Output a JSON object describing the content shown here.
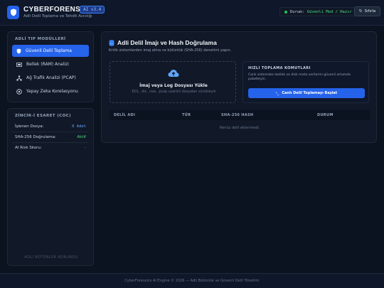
{
  "header": {
    "brand": "CYBERFORENSICS",
    "version": "AI v3.4",
    "subtitle": "Adli Delil Toplama ve Tehdit Avcılığı",
    "status_label": "Durum:",
    "status_value": "Güvenli Mod / Hazır",
    "reset_label": "Sıfırla"
  },
  "sidebar": {
    "modules_title": "ADLİ TIP MODÜLLERİ",
    "items": [
      {
        "label": "Güvenli Delil Toplama",
        "icon": "shield-icon"
      },
      {
        "label": "Bellek (RAM) Analizi",
        "icon": "memory-icon"
      },
      {
        "label": "Ağ Trafik Analizi (PCAP)",
        "icon": "network-icon"
      },
      {
        "label": "Yapay Zeka Korelasyonu",
        "icon": "brain-icon"
      }
    ],
    "coc_title": "ZİNCİR-İ ESARET (COC)",
    "coc_rows": [
      {
        "label": "İşlenen Dosya:",
        "value": "0 Adet"
      },
      {
        "label": "SHA-256 Doğrulama:",
        "value": "Aktif"
      },
      {
        "label": "AI Risk Skoru:",
        "value": "-"
      }
    ],
    "coc_footer": "ADLİ BÜTÜNLÜK KORUNDU"
  },
  "main": {
    "title": "Adli Delil İmajı ve Hash Doğrulama",
    "subtitle": "Kritik sistemlerden imaj alma ve bütünlük (SHA-256) denetimi yapın.",
    "upload_title": "İmaj veya Log Dosyası Yükle",
    "upload_sub": ".E01, .dd, .raw, .pcap uzantılı dosyaları sürükleyin",
    "quick_title": "HIZLI TOPLAMA KOMUTLARI",
    "quick_desc": "Canlı sistemden bellek ve disk meta verilerini güvenli ortamda paketleyin.",
    "quick_btn": "Canlı Delil Toplamayı Başlat",
    "table_headers": [
      "DELİL ADI",
      "TÜR",
      "SHA-256 HASH",
      "DURUM"
    ],
    "empty_text": "Henüz delil eklenmedi."
  },
  "footer": "CyberForensics AI Engine © 2026 — Adli Bütünlük ve Güvenli Delil Yönetimi",
  "colors": {
    "accent": "#2563eb",
    "ok": "#4ade80",
    "bg": "#0b1220"
  }
}
